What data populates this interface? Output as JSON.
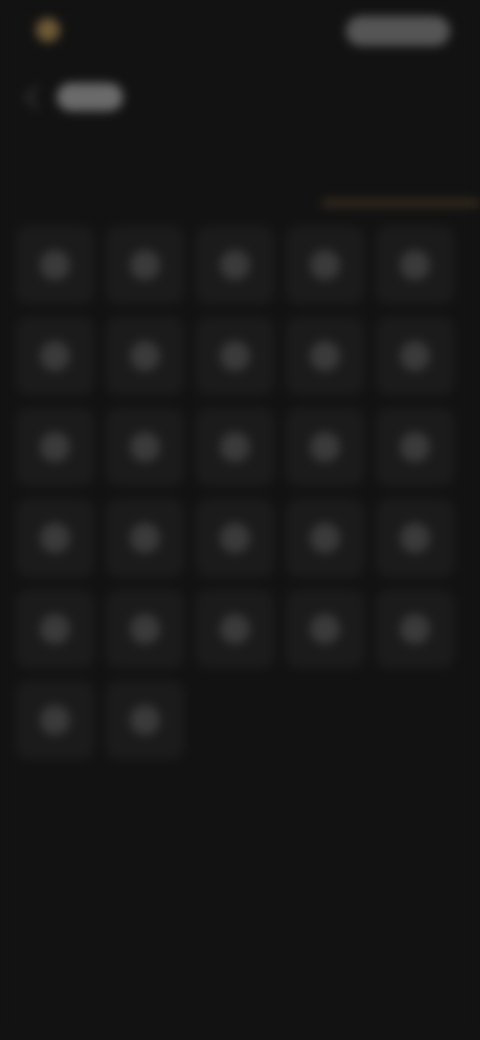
{
  "header": {
    "logo_icon": "logo-icon",
    "app_name": "",
    "action_label": ""
  },
  "nav": {
    "back_icon": "chevron-left-icon",
    "section_label": ""
  },
  "tabs": [
    {
      "label": "",
      "active": false
    },
    {
      "label": "",
      "active": false
    },
    {
      "label": "",
      "active": true
    }
  ],
  "colors": {
    "background": "#121212",
    "accent": "#6e5a36",
    "tile": "#1b1b1b"
  },
  "grid": {
    "tiles": [
      {
        "label": "",
        "icon": "item-icon"
      },
      {
        "label": "",
        "icon": "item-icon"
      },
      {
        "label": "",
        "icon": "item-icon"
      },
      {
        "label": "",
        "icon": "item-icon"
      },
      {
        "label": "",
        "icon": "item-icon"
      },
      {
        "label": "",
        "icon": "item-icon"
      },
      {
        "label": "",
        "icon": "item-icon"
      },
      {
        "label": "",
        "icon": "item-icon"
      },
      {
        "label": "",
        "icon": "item-icon"
      },
      {
        "label": "",
        "icon": "item-icon"
      },
      {
        "label": "",
        "icon": "item-icon"
      },
      {
        "label": "",
        "icon": "item-icon"
      },
      {
        "label": "",
        "icon": "item-icon"
      },
      {
        "label": "",
        "icon": "item-icon"
      },
      {
        "label": "",
        "icon": "item-icon"
      },
      {
        "label": "",
        "icon": "item-icon"
      },
      {
        "label": "",
        "icon": "item-icon"
      },
      {
        "label": "",
        "icon": "item-icon"
      },
      {
        "label": "",
        "icon": "item-icon"
      },
      {
        "label": "",
        "icon": "item-icon"
      },
      {
        "label": "",
        "icon": "item-icon"
      },
      {
        "label": "",
        "icon": "item-icon"
      },
      {
        "label": "",
        "icon": "item-icon"
      },
      {
        "label": "",
        "icon": "item-icon"
      },
      {
        "label": "",
        "icon": "item-icon"
      },
      {
        "label": "",
        "icon": "item-icon"
      },
      {
        "label": "",
        "icon": "item-icon"
      }
    ]
  }
}
